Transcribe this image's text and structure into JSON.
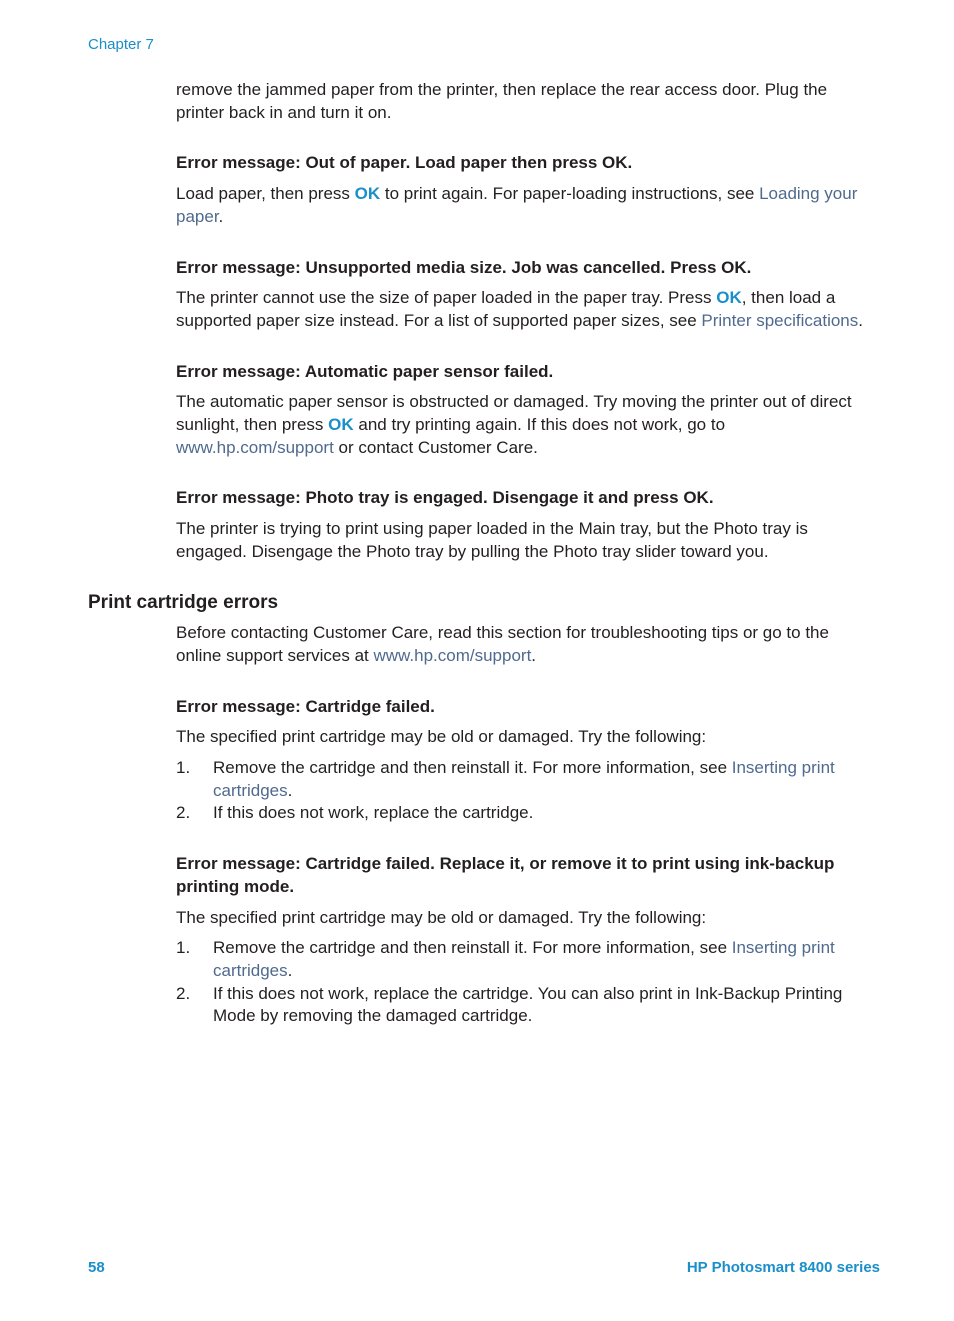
{
  "header": {
    "chapter": "Chapter 7"
  },
  "intro": {
    "text": "remove the jammed paper from the printer, then replace the rear access door. Plug the printer back in and turn it on."
  },
  "errors": [
    {
      "heading": "Error message: Out of paper. Load paper then press OK.",
      "body_parts": [
        "Load paper, then press ",
        "OK",
        " to print again. For paper-loading instructions, see ",
        "Loading your paper",
        "."
      ]
    },
    {
      "heading": "Error message: Unsupported media size. Job was cancelled. Press OK.",
      "body_parts": [
        "The printer cannot use the size of paper loaded in the paper tray. Press ",
        "OK",
        ", then load a supported paper size instead. For a list of supported paper sizes, see ",
        "Printer specifications",
        "."
      ]
    },
    {
      "heading": "Error message: Automatic paper sensor failed.",
      "body_parts": [
        "The automatic paper sensor is obstructed or damaged. Try moving the printer out of direct sunlight, then press ",
        "OK",
        " and try printing again. If this does not work, go to ",
        "www.hp.com/support",
        " or contact Customer Care."
      ]
    },
    {
      "heading": "Error message: Photo tray is engaged. Disengage it and press OK.",
      "body": "The printer is trying to print using paper loaded in the Main tray, but the Photo tray is engaged. Disengage the Photo tray by pulling the Photo tray slider toward you."
    }
  ],
  "cartridge_section": {
    "title": "Print cartridge errors",
    "intro_parts": [
      "Before contacting Customer Care, read this section for troubleshooting tips or go to the online support services at ",
      "www.hp.com/support",
      "."
    ],
    "errors": [
      {
        "heading": "Error message: Cartridge failed.",
        "body": "The specified print cartridge may be old or damaged. Try the following:",
        "steps": [
          {
            "num": "1.",
            "text": "Remove the cartridge and then reinstall it. For more information, see ",
            "link": "Inserting print cartridges",
            "after": "."
          },
          {
            "num": "2.",
            "text": "If this does not work, replace the cartridge."
          }
        ]
      },
      {
        "heading": "Error message: Cartridge failed. Replace it, or remove it to print using ink-backup printing mode.",
        "body": "The specified print cartridge may be old or damaged. Try the following:",
        "steps": [
          {
            "num": "1.",
            "text": "Remove the cartridge and then reinstall it. For more information, see ",
            "link": "Inserting print cartridges",
            "after": "."
          },
          {
            "num": "2.",
            "text": "If this does not work, replace the cartridge. You can also print in Ink-Backup Printing Mode by removing the damaged cartridge."
          }
        ]
      }
    ]
  },
  "footer": {
    "page_number": "58",
    "product": "HP Photosmart 8400 series"
  },
  "colors": {
    "accent": "#1a8fc9",
    "link": "#4f6a8e",
    "text": "#231f20"
  }
}
